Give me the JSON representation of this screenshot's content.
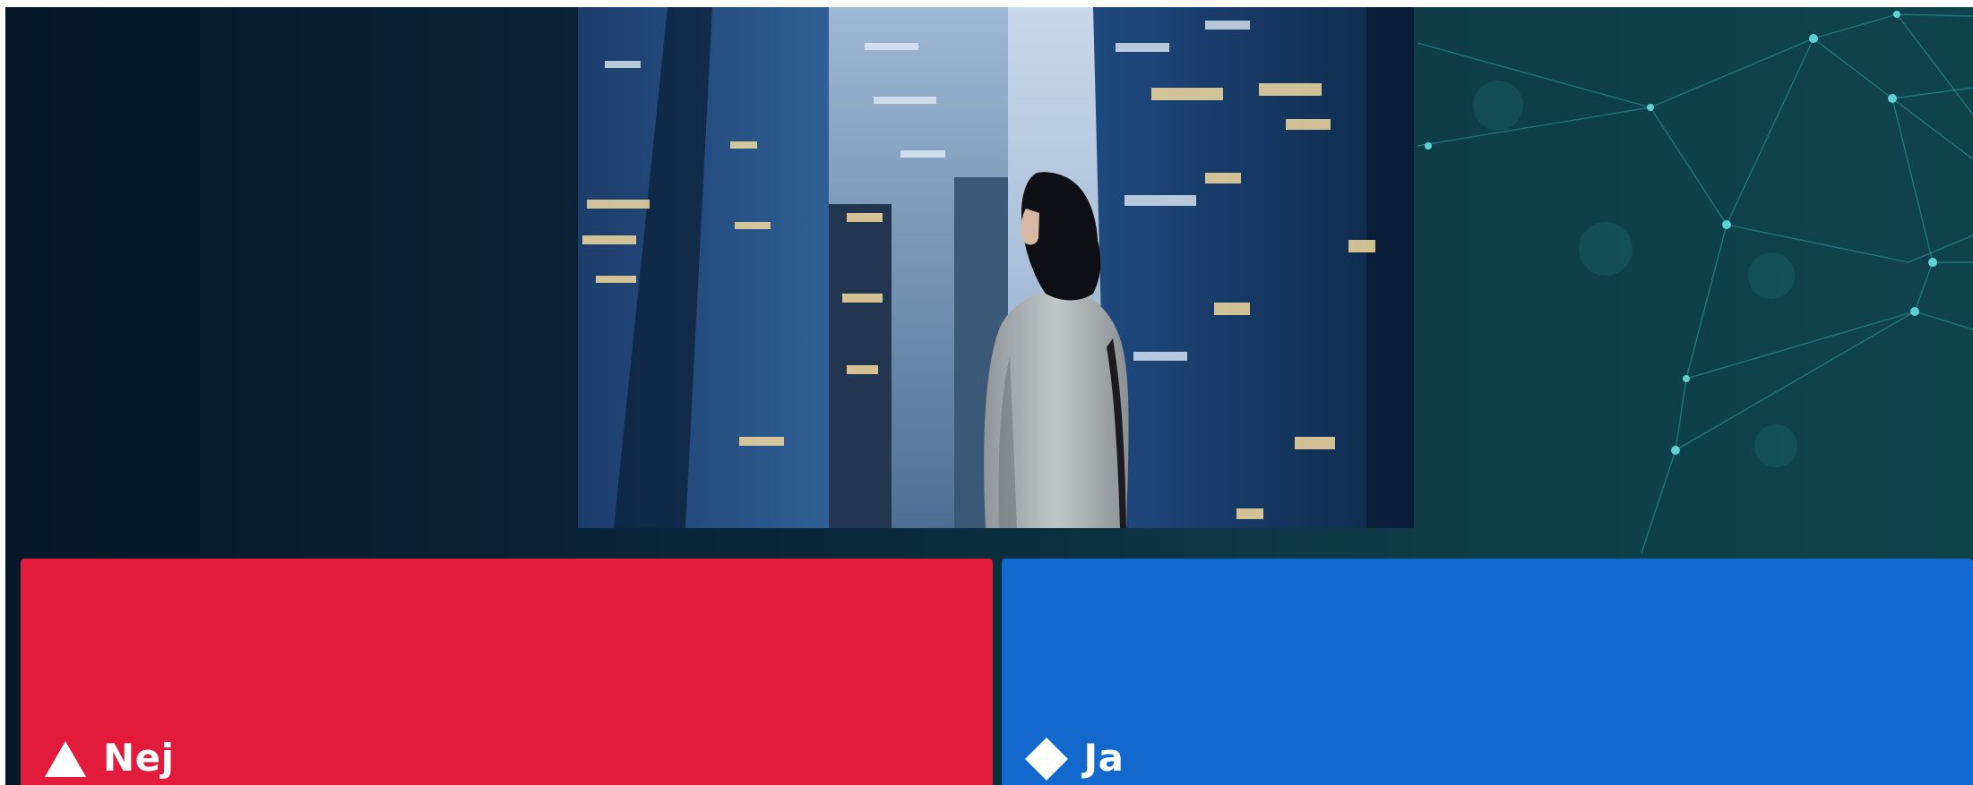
{
  "background": {
    "colors": {
      "left": "#051728",
      "right": "#0f434c",
      "network_lines": "#3fb6b8"
    },
    "decoration_icon": "network-graph-icon"
  },
  "question_media": {
    "subject": "question-image"
  },
  "answers": [
    {
      "label": "Nej",
      "shape": "triangle-icon",
      "color": "#e21b3c"
    },
    {
      "label": "Ja",
      "shape": "diamond-icon",
      "color": "#1368ce"
    }
  ]
}
